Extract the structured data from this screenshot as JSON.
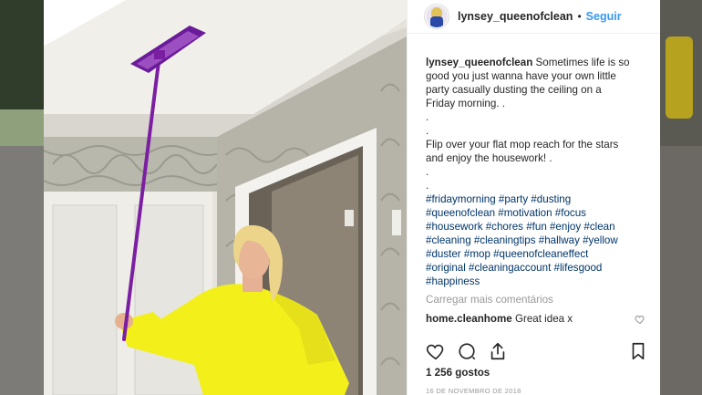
{
  "post": {
    "username": "lynsey_queenofclean",
    "separator": "•",
    "follow_label": "Seguir",
    "caption_user": "lynsey_queenofclean",
    "caption_lines": [
      "Sometimes life is so",
      "good you just wanna have your own little",
      "party casually dusting the ceiling on a",
      "Friday morning. .",
      ".",
      ".",
      "Flip over your flat mop reach for the stars",
      "and enjoy the housework! .",
      ".",
      "."
    ],
    "hashtag_lines": [
      "#fridaymorning #party #dusting",
      "#queenofclean #motivation #focus",
      "#housework #chores #fun #enjoy #clean",
      "#cleaning #cleaningtips #hallway #yellow",
      "#duster #mop #queenofcleaneffect",
      "#original #cleaningaccount #lifesgood",
      "#happiness"
    ],
    "load_more": "Carregar mais comentários",
    "comment_user": "home.cleanhome",
    "comment_text": "Great idea x",
    "likes": "1 256 gostos",
    "date": "16 DE NOVEMBRO DE 2018"
  },
  "colors": {
    "link": "#3897f0",
    "hashtag": "#003569",
    "mop": "#7b1fa2",
    "sweater": "#f2ef1a"
  },
  "icons": [
    "heart-icon",
    "comment-icon",
    "share-icon",
    "bookmark-icon",
    "small-heart-icon"
  ]
}
